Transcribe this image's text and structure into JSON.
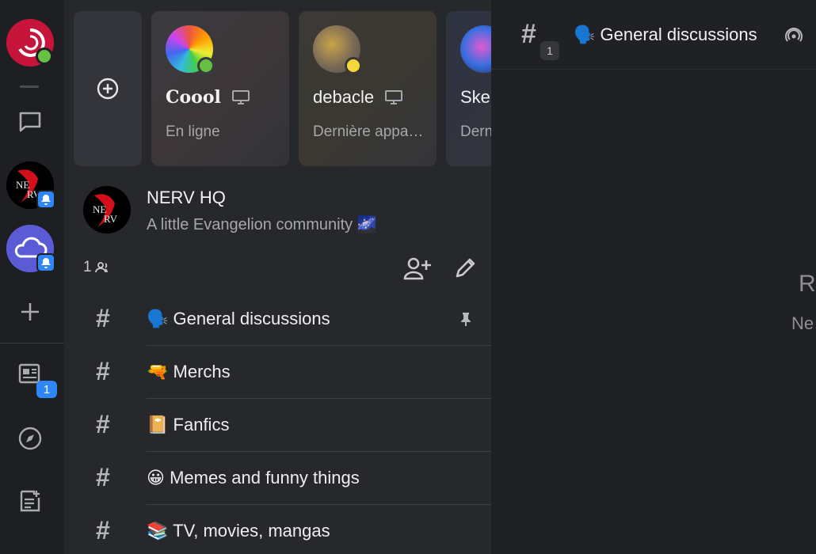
{
  "rail": {
    "notification_count": "1"
  },
  "cards": {
    "u1": {
      "name": "Coool",
      "status": "En ligne"
    },
    "u2": {
      "name": "debacle",
      "status": "Dernière appa…"
    },
    "u3": {
      "name": "Ske",
      "status": "Dern"
    }
  },
  "server": {
    "name": "NERV HQ",
    "description": "A little Evangelion community 🌌",
    "member_count": "1"
  },
  "channels": [
    {
      "emoji": "🗣️",
      "name": "General discussions"
    },
    {
      "emoji": "🔫",
      "name": "Merchs"
    },
    {
      "emoji": "📔",
      "name": "Fanfics"
    },
    {
      "emoji": "😀",
      "name": "Memes and funny things"
    },
    {
      "emoji": "📚",
      "name": "TV, movies, mangas"
    }
  ],
  "header": {
    "title": "🗣️ General discussions",
    "count": "1"
  },
  "empty_state": {
    "title": "Ri",
    "subtitle": "Ne"
  },
  "colors": {
    "accent": "#2f86f6",
    "online": "#66c143",
    "away": "#f5d63d"
  }
}
